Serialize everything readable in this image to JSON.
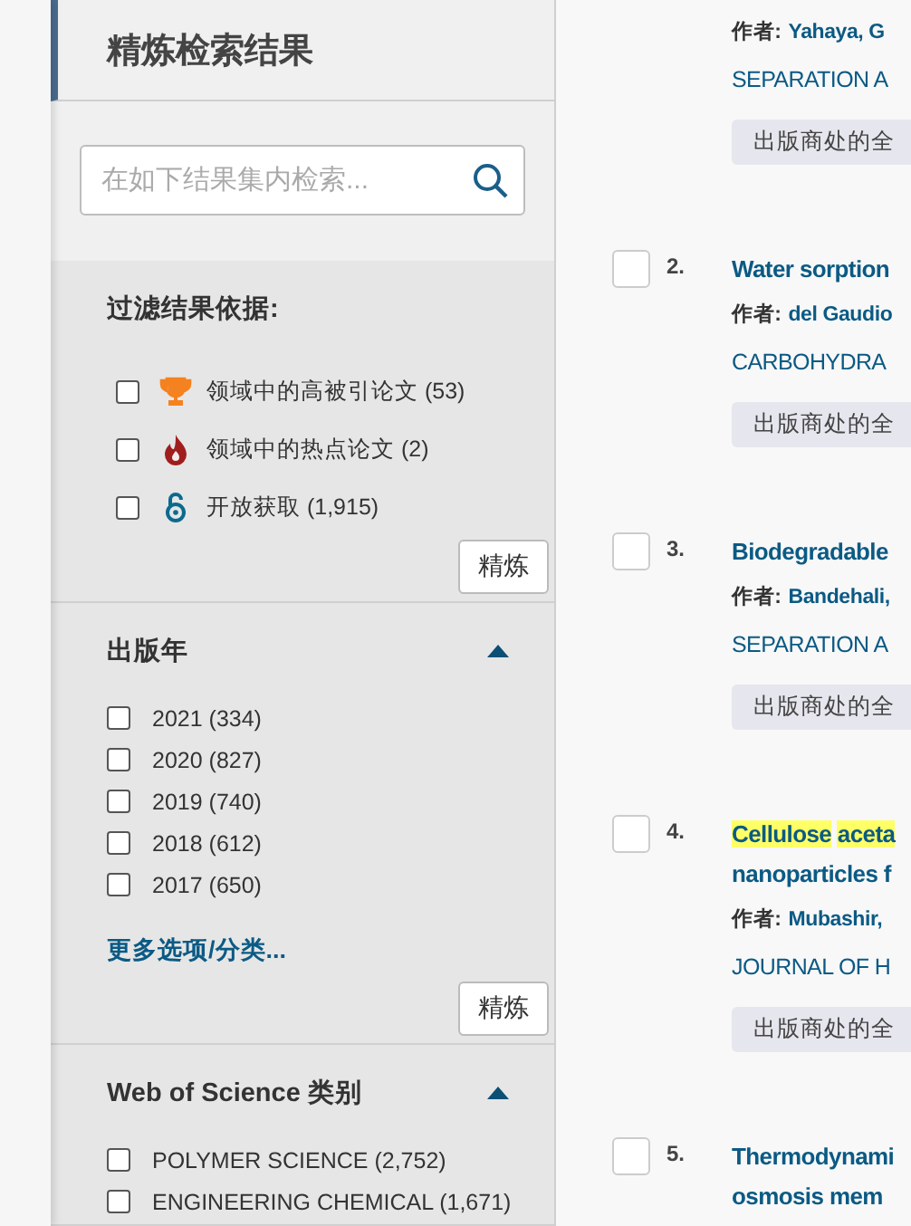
{
  "sidebar": {
    "title": "精炼检索结果",
    "search": {
      "placeholder": "在如下结果集内检索..."
    },
    "filters": {
      "heading": "过滤结果依据:",
      "items": [
        {
          "kind": "trophy",
          "label": "领域中的高被引论文 (53)",
          "checked": false
        },
        {
          "kind": "flame",
          "label": "领域中的热点论文 (2)",
          "checked": false
        },
        {
          "kind": "open-access",
          "label": "开放获取 (1,915)",
          "checked": false
        }
      ],
      "button": "精炼"
    },
    "sections": [
      {
        "title": "出版年",
        "expanded": true,
        "items": [
          {
            "label": "2021 (334)",
            "checked": false
          },
          {
            "label": "2020 (827)",
            "checked": false
          },
          {
            "label": "2019 (740)",
            "checked": false
          },
          {
            "label": "2018 (612)",
            "checked": false
          },
          {
            "label": "2017 (650)",
            "checked": false
          }
        ],
        "more": "更多选项/分类...",
        "button": "精炼"
      },
      {
        "title": "Web of Science 类别",
        "expanded": true,
        "items": [
          {
            "label": "POLYMER SCIENCE (2,752)",
            "checked": false
          },
          {
            "label": "ENGINEERING CHEMICAL (1,671)",
            "checked": false
          }
        ]
      }
    ]
  },
  "results": [
    {
      "author_label": "作者:",
      "author": "Yahaya, G",
      "journal": "SEPARATION A",
      "fulltext": "出版商处的全"
    },
    {
      "checked": false,
      "number": "2.",
      "title": [
        [
          {
            "text": "Water sorption",
            "highlighted": false
          }
        ]
      ],
      "author_label": "作者:",
      "author": "del Gaudio",
      "journal": "CARBOHYDRA",
      "fulltext": "出版商处的全"
    },
    {
      "checked": false,
      "number": "3.",
      "title": [
        [
          {
            "text": "Biodegradable",
            "highlighted": false
          }
        ]
      ],
      "author_label": "作者:",
      "author": "Bandehali,",
      "journal": "SEPARATION A",
      "fulltext": "出版商处的全"
    },
    {
      "checked": false,
      "number": "4.",
      "title": [
        [
          {
            "text": "Cellulose",
            "highlighted": true
          },
          {
            "text": "aceta",
            "highlighted": true
          }
        ],
        [
          {
            "text": "nanoparticles f",
            "highlighted": false
          }
        ]
      ],
      "author_label": "作者:",
      "author": "Mubashir,",
      "journal": "JOURNAL OF H",
      "fulltext": "出版商处的全"
    },
    {
      "checked": false,
      "number": "5.",
      "title": [
        [
          {
            "text": "Thermodynami",
            "highlighted": false
          }
        ],
        [
          {
            "text": "osmosis mem",
            "highlighted": false
          }
        ]
      ]
    }
  ]
}
